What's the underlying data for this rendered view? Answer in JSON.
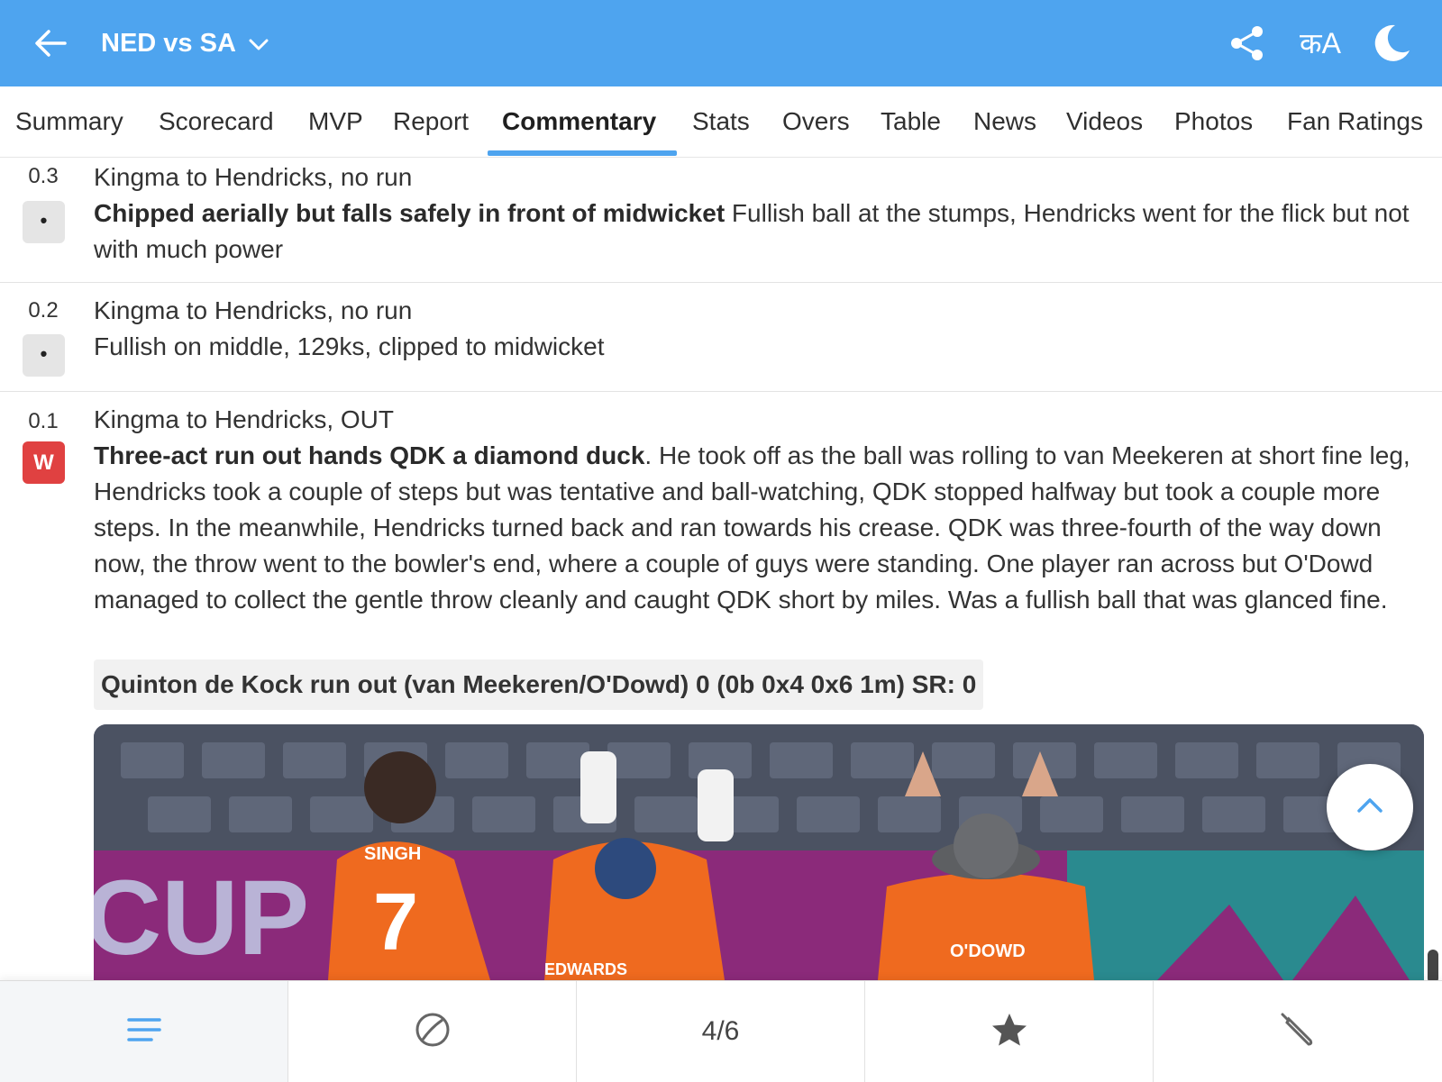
{
  "header": {
    "title": "NED vs SA",
    "icons": [
      "back-arrow-icon",
      "chevron-down-icon",
      "share-icon",
      "language-icon",
      "dark-mode-moon-icon"
    ],
    "lang_label": "कA",
    "background": "#4ea4ef"
  },
  "tabs": [
    {
      "label": "Summary"
    },
    {
      "label": "Scorecard"
    },
    {
      "label": "MVP"
    },
    {
      "label": "Report"
    },
    {
      "label": "Commentary",
      "active": true
    },
    {
      "label": "Stats"
    },
    {
      "label": "Overs"
    },
    {
      "label": "Table"
    },
    {
      "label": "News"
    },
    {
      "label": "Videos"
    },
    {
      "label": "Photos"
    },
    {
      "label": "Fan Ratings"
    }
  ],
  "commentary": [
    {
      "over": "0.3",
      "ball": "•",
      "title": "Kingma to Hendricks, no run",
      "headline": "Chipped aerially but falls safely in front of midwicket",
      "text": " Fullish ball at the stumps, Hendricks went for the flick but not with much power"
    },
    {
      "over": "0.2",
      "ball": "•",
      "title": "Kingma to Hendricks, no run",
      "text": "Fullish on middle, 129ks, clipped to midwicket"
    },
    {
      "over": "0.1",
      "ball": "W",
      "title": "Kingma to Hendricks, OUT",
      "headline": "Three-act run out hands QDK a diamond duck",
      "text": ". He took off as the ball was rolling to van Meekeren at short fine leg, Hendricks took a couple of steps but was tentative and ball-watching, QDK stopped halfway but took a couple more steps. In the meanwhile, Hendricks turned back and ran towards his crease. QDK was three-fourth of the way down now, the throw went to the bowler's end, where a couple of guys were standing. One player ran across but O'Dowd managed to collect the gentle throw cleanly and caught QDK short by miles. Was a fullish ball that was glanced fine.",
      "dismissal": "Quinton de Kock run out (van Meekeren/O'Dowd) 0 (0b 0x4 0x6 1m) SR: 0"
    }
  ],
  "photo": {
    "banner_text": "CUP",
    "jersey_names": [
      "SINGH",
      "EDWARDS",
      "O'DOWD"
    ],
    "jersey_number": "7",
    "colors": {
      "jersey": "#ef6a1f",
      "banner": "#8b2a7a",
      "stand": "#4b5262"
    }
  },
  "bottom_bar": {
    "items": [
      "menu-icon",
      "ball-icon",
      "page-counter",
      "star-icon",
      "bat-icon"
    ],
    "page_counter": "4/6"
  },
  "colors": {
    "accent": "#4ea4ef",
    "wicket": "#e04141",
    "badge_grey": "#e5e5e5"
  }
}
